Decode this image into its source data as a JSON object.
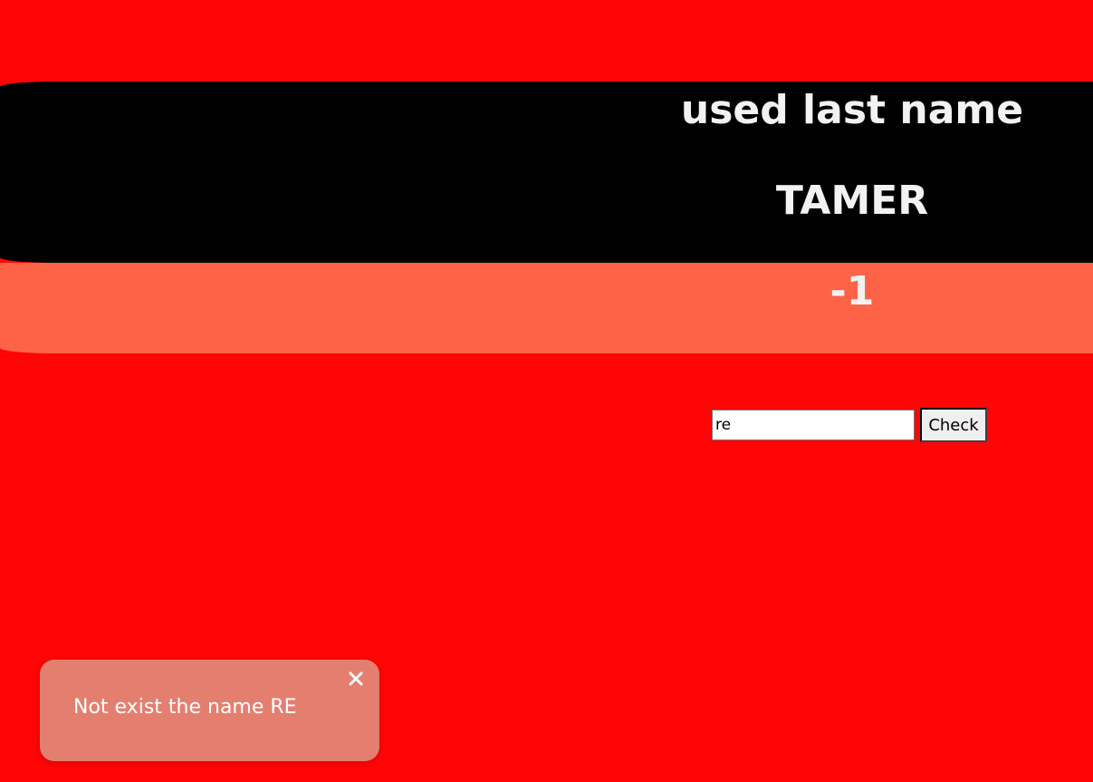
{
  "header": {
    "title": "used last name",
    "last_name": "TAMER",
    "count": "-1"
  },
  "form": {
    "input_value": "re",
    "button_label": "Check"
  },
  "toast": {
    "message": "Not exist the name RE",
    "close_icon": "close-icon"
  },
  "colors": {
    "background": "#ff0606",
    "band_dark": "#000000",
    "band_light": "#ff6347",
    "toast": "#e47f6f"
  }
}
